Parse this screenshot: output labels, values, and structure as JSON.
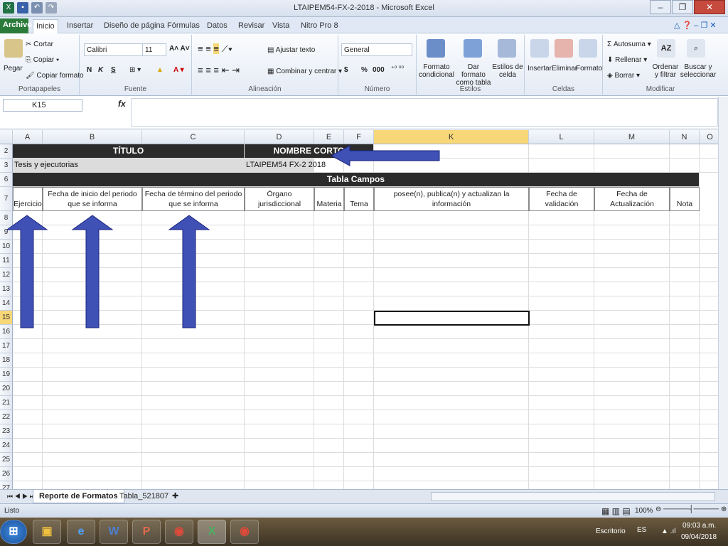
{
  "window": {
    "title": "LTAIPEM54-FX-2-2018 - Microsoft Excel"
  },
  "ribbon_tabs": [
    "Archivo",
    "Inicio",
    "Insertar",
    "Diseño de página",
    "Fórmulas",
    "Datos",
    "Revisar",
    "Vista",
    "Nitro Pro 8"
  ],
  "clipboard": {
    "paste": "Pegar",
    "cut": "Cortar",
    "copy": "Copiar",
    "format_painter": "Copiar formato",
    "label": "Portapapeles"
  },
  "font": {
    "name": "Calibri",
    "size": "11",
    "bold": "N",
    "italic": "K",
    "underline": "S",
    "label": "Fuente"
  },
  "alignment": {
    "wrap": "Ajustar texto",
    "merge": "Combinar y centrar",
    "label": "Alineación"
  },
  "number": {
    "format": "General",
    "currency": "$",
    "percent": "%",
    "thousands": "000",
    "label": "Número"
  },
  "styles": {
    "conditional": "Formato condicional",
    "as_table": "Dar formato como tabla",
    "cell_styles": "Estilos de celda",
    "label": "Estilos"
  },
  "cells": {
    "insert": "Insertar",
    "delete": "Eliminar",
    "format": "Formato",
    "label": "Celdas"
  },
  "editing": {
    "autosum": "Autosuma",
    "fill": "Rellenar",
    "clear": "Borrar",
    "sort": "Ordenar y filtrar",
    "find": "Buscar y seleccionar",
    "label": "Modificar"
  },
  "formula_bar": {
    "name_box": "K15",
    "fx": "fx",
    "value": ""
  },
  "columns": [
    {
      "id": "A",
      "w": 42
    },
    {
      "id": "B",
      "w": 140
    },
    {
      "id": "C",
      "w": 144
    },
    {
      "id": "D",
      "w": 98
    },
    {
      "id": "E",
      "w": 42
    },
    {
      "id": "F",
      "w": 42
    },
    {
      "id": "K",
      "w": 218
    },
    {
      "id": "L",
      "w": 92
    },
    {
      "id": "M",
      "w": 106
    },
    {
      "id": "N",
      "w": 42
    },
    {
      "id": "O",
      "w": 30
    }
  ],
  "sheet": {
    "title_label": "TÍTULO",
    "short_name_label": "NOMBRE CORTO",
    "title_value": "Tesis y ejecutorias",
    "short_name_value": "LTAIPEM54 FX-2 2018",
    "table_label": "Tabla Campos",
    "headers": [
      "Ejercicio",
      "Fecha de inicio del periodo que se informa",
      "Fecha de término del periodo que se informa",
      "Órgano jurisdiccional",
      "Materia",
      "Tema",
      "Area(s) responsable(s) que genera(n), posee(n), publica(n) y actualizan la información",
      "Fecha de validación",
      "Fecha de Actualización",
      "Nota"
    ],
    "row_numbers": [
      "2",
      "3",
      "6",
      "7",
      "8",
      "9",
      "10",
      "11",
      "12",
      "13",
      "14",
      "15",
      "16",
      "17",
      "18",
      "19",
      "20",
      "21",
      "22",
      "23",
      "24",
      "25",
      "26",
      "27"
    ],
    "active_row": "15"
  },
  "sheet_tabs": [
    "Reporte de Formatos",
    "Tabla_521807"
  ],
  "status": {
    "ready": "Listo",
    "zoom": "100%"
  },
  "taskbar": {
    "desk": "Escritorio",
    "lang": "ES",
    "time": "09:03 a.m.",
    "date": "09/04/2018"
  },
  "colors": {
    "arrow": "#3f51b5",
    "header_dark": "#2b2b2b",
    "gray_cell": "#dcdcdc",
    "excel_green": "#2a7a3a"
  }
}
